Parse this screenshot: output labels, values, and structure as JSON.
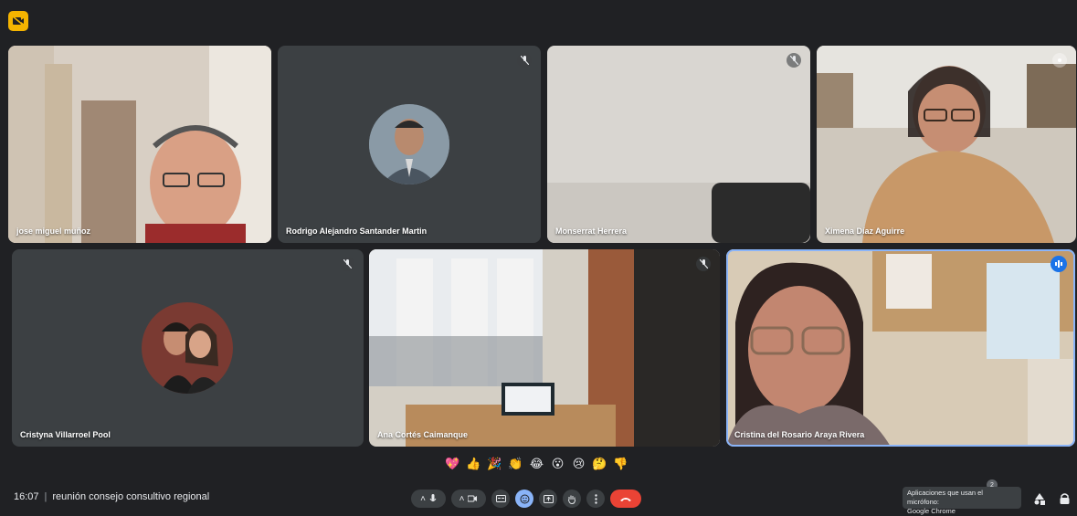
{
  "participants": [
    {
      "name": "jose miguel muñoz"
    },
    {
      "name": "Rodrigo Alejandro Santander Martin"
    },
    {
      "name": "Monserrat Herrera"
    },
    {
      "name": "Ximena Díaz Aguirre"
    },
    {
      "name": "Cristyna Villarroel Pool"
    },
    {
      "name": "Ana Cortés Caimanque"
    },
    {
      "name": "Cristina del Rosario Araya Rivera"
    }
  ],
  "meeting": {
    "time": "16:07",
    "title": "reunión consejo consultivo regional"
  },
  "reactions": [
    "💖",
    "👍",
    "🎉",
    "👏",
    "😂",
    "😮",
    "😢",
    "🤔",
    "👎"
  ],
  "notification": {
    "text_line1": "Aplicaciones que usan el micrófono:",
    "text_line2": "Google Chrome",
    "count": "2"
  },
  "colors": {
    "background": "#202124",
    "tile": "#3c4043",
    "hangup": "#ea4335",
    "accent": "#8ab4f8",
    "badge": "#f5b400"
  }
}
